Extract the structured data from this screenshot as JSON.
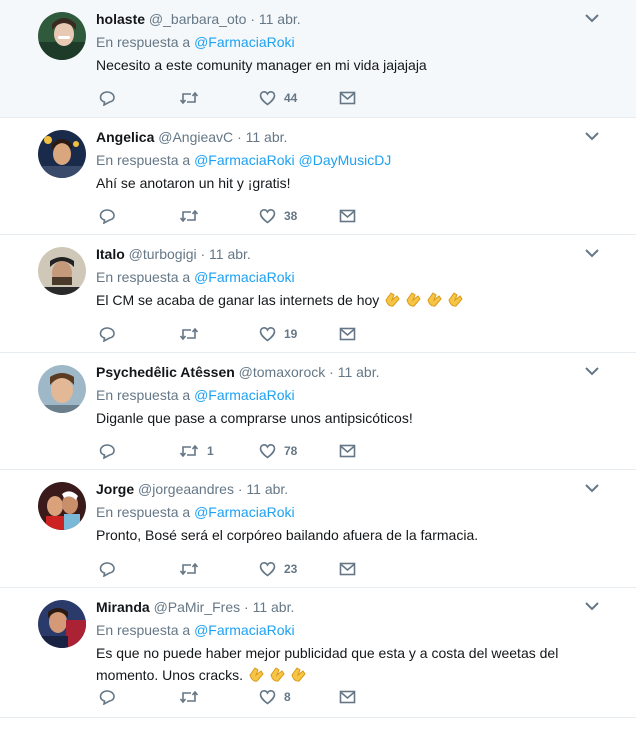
{
  "colors": {
    "accent": "#1da1f2",
    "muted": "#657786",
    "text": "#14171a",
    "highlight": "#f5f8fa"
  },
  "icons": {
    "reply": "reply-icon",
    "retweet": "retweet-icon",
    "like": "heart-icon",
    "dm": "mail-icon",
    "menu": "chevron-down-icon",
    "emoji": "clapping-hands-emoji"
  },
  "tweets": [
    {
      "name": "holaste",
      "handle": "@_barbara_oto",
      "time": "11 abr.",
      "reply_prefix": "En respuesta a",
      "mentions": [
        "@FarmaciaRoki"
      ],
      "text": "Necesito a este comunity manager en mi vida jajajaja",
      "lines": [],
      "retweets": "",
      "likes": "44"
    },
    {
      "name": "Angelica",
      "handle": "@AngieavC",
      "time": "11 abr.",
      "reply_prefix": "En respuesta a",
      "mentions": [
        "@FarmaciaRoki",
        "@DayMusicDJ"
      ],
      "text": "Ahí se anotaron un hit y ¡gratis!",
      "lines": [],
      "retweets": "",
      "likes": "38"
    },
    {
      "name": "Italo",
      "handle": "@turbogigi",
      "time": "11 abr.",
      "reply_prefix": "En respuesta a",
      "mentions": [
        "@FarmaciaRoki"
      ],
      "text": "El CM se acaba de ganar las internets de hoy",
      "lines": [],
      "retweets": "",
      "likes": "19"
    },
    {
      "name": "Psychedêlic Atêssen",
      "handle": "@tomaxorock",
      "time": "11 abr.",
      "reply_prefix": "En respuesta a",
      "mentions": [
        "@FarmaciaRoki"
      ],
      "text": "Diganle que pase a comprarse unos antipsicóticos!",
      "lines": [],
      "retweets": "1",
      "likes": "78"
    },
    {
      "name": "Jorge",
      "handle": "@jorgeaandres",
      "time": "11 abr.",
      "reply_prefix": "En respuesta a",
      "mentions": [
        "@FarmaciaRoki"
      ],
      "text": "Pronto, Bosé será el corpóreo bailando afuera de la farmacia.",
      "lines": [],
      "retweets": "",
      "likes": "23"
    },
    {
      "name": "Miranda",
      "handle": "@PaMir_Fres",
      "time": "11 abr.",
      "reply_prefix": "En respuesta a",
      "mentions": [
        "@FarmaciaRoki"
      ],
      "text": "",
      "lines": [
        "Es que no puede haber mejor publicidad que esta y a costa del weetas del",
        "momento. Unos cracks."
      ],
      "retweets": "",
      "likes": "8"
    }
  ]
}
